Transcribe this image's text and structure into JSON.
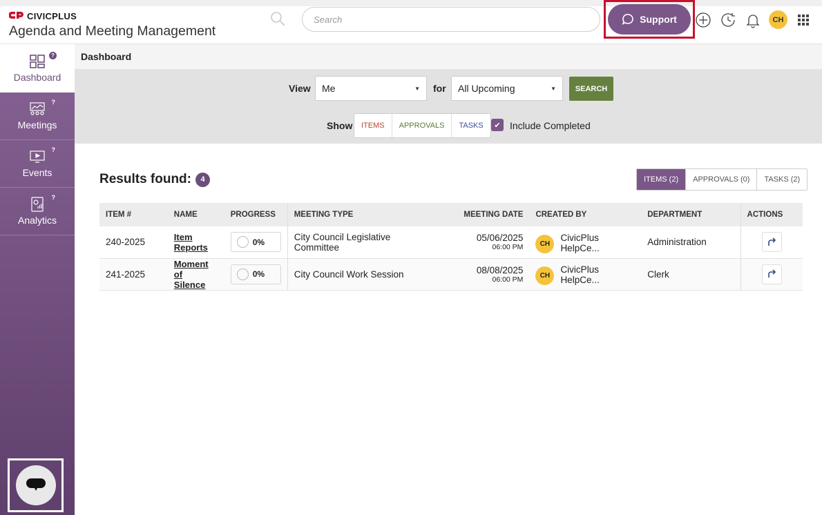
{
  "brand": {
    "name": "CIVICPLUS",
    "mark": "CP",
    "app_title": "Agenda and Meeting Management"
  },
  "header": {
    "search_placeholder": "Search",
    "support_label": "Support",
    "avatar_initials": "CH",
    "icons": [
      "search-icon",
      "plus-circle-icon",
      "history-icon",
      "bell-icon",
      "app-grid-icon"
    ]
  },
  "sidebar": {
    "items": [
      {
        "label": "Dashboard",
        "icon": "dashboard-icon",
        "help": "?"
      },
      {
        "label": "Meetings",
        "icon": "meetings-icon",
        "help": "?"
      },
      {
        "label": "Events",
        "icon": "events-icon",
        "help": "?"
      },
      {
        "label": "Analytics",
        "icon": "analytics-icon",
        "help": "?"
      }
    ]
  },
  "breadcrumb": "Dashboard",
  "filter": {
    "view_label": "View",
    "view_value": "Me",
    "for_label": "for",
    "for_value": "All Upcoming",
    "search_button": "SEARCH",
    "show_label": "Show",
    "show_options": [
      "ITEMS",
      "APPROVALS",
      "TASKS"
    ],
    "include_completed": "Include Completed"
  },
  "results": {
    "title": "Results found:",
    "count": "4",
    "tabs": [
      "ITEMS (2)",
      "APPROVALS (0)",
      "TASKS (2)"
    ]
  },
  "table": {
    "headers": [
      "ITEM #",
      "NAME",
      "PROGRESS",
      "MEETING TYPE",
      "MEETING DATE",
      "CREATED BY",
      "DEPARTMENT",
      "ACTIONS"
    ],
    "rows": [
      {
        "item": "240-2025",
        "name_line1": "Item",
        "name_line2": "Reports",
        "progress": "0%",
        "meeting_type": "City Council Legislative Committee",
        "date": "05/06/2025",
        "time": "06:00 PM",
        "creator_initials": "CH",
        "creator": "CivicPlus HelpCe...",
        "department": "Administration"
      },
      {
        "item": "241-2025",
        "name_line1": "Moment of",
        "name_line2": "Silence",
        "progress": "0%",
        "meeting_type": "City Council Work Session",
        "date": "08/08/2025",
        "time": "06:00 PM",
        "creator_initials": "CH",
        "creator": "CivicPlus HelpCe...",
        "department": "Clerk"
      }
    ]
  },
  "colors": {
    "accent": "#7a5689",
    "search_btn": "#66813f",
    "highlight": "#c8102e",
    "avatar": "#f5c33b"
  }
}
